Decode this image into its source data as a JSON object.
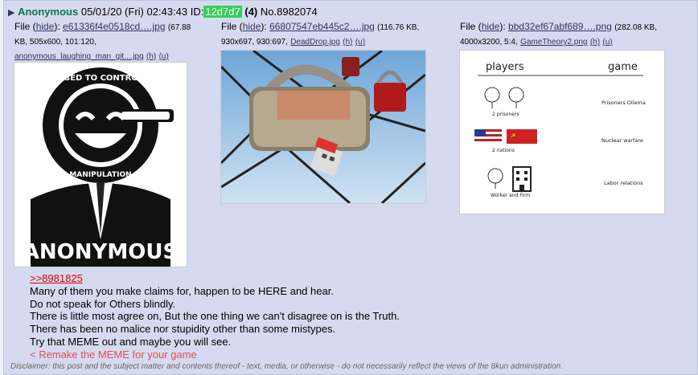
{
  "post": {
    "toggle_icon": "triangle-right-icon",
    "name": "Anonymous",
    "datetime": "05/01/20 (Fri) 02:43:43",
    "id_label": "ID:",
    "id": "12d7d7",
    "reply_count": "(4)",
    "number": "No.8982074"
  },
  "files": [
    {
      "prefix": "File",
      "hide": "hide",
      "name": "e61336f4e0518cd….jpg",
      "meta1": "(67.88",
      "meta2": "KB, 505x600, 101:120,",
      "original": "anonymous_laughing_man_git....jpg",
      "h": "(h)",
      "u": "(u)",
      "image_label": "ANONYMOUS",
      "logo_ring_text": "FEAR IS USED TO CONTROL YOU · MEDIA IS MANIPULATION"
    },
    {
      "prefix": "File",
      "hide": "hide",
      "name": "66807547eb445c2….jpg",
      "meta1": "(116.76 KB,",
      "meta2": "930x697, 930:697,",
      "original": "DeadDrop.jpg",
      "h": "(h)",
      "u": "(u)"
    },
    {
      "prefix": "File",
      "hide": "hide",
      "name": "bbd32ef67abf689….png",
      "meta1": "(282.08 KB,",
      "meta2": "4000x3200, 5:4,",
      "original": "GameTheory2.png",
      "h": "(h)",
      "u": "(u)",
      "diagram": {
        "col1": "players",
        "col2": "game",
        "row1_caption": "2 prisoners",
        "row1_game": "Prisoners Dilema",
        "row2_caption": "2 nations",
        "row2_game": "Nuclear warfare",
        "row3_caption": "Worker and Firm",
        "row3_game": "Labor relations"
      }
    }
  ],
  "message": {
    "quote": ">>8981825",
    "line1": "Many of them you make claims for, happen to be HERE and hear.",
    "line2": "Do not speak for Others blindly.",
    "line3": "There is little most agree on, But the one thing we can't disagree on is the Truth.",
    "line4": "There has been no malice nor stupidity other than some mistypes.",
    "line5": "Try that MEME out and maybe you will see.",
    "line6": "< Remake the MEME for your game"
  },
  "disclaimer": "Disclaimer: this post and the subject matter and contents thereof - text, media, or otherwise - do not necessarily reflect the views of the 8kun administration."
}
